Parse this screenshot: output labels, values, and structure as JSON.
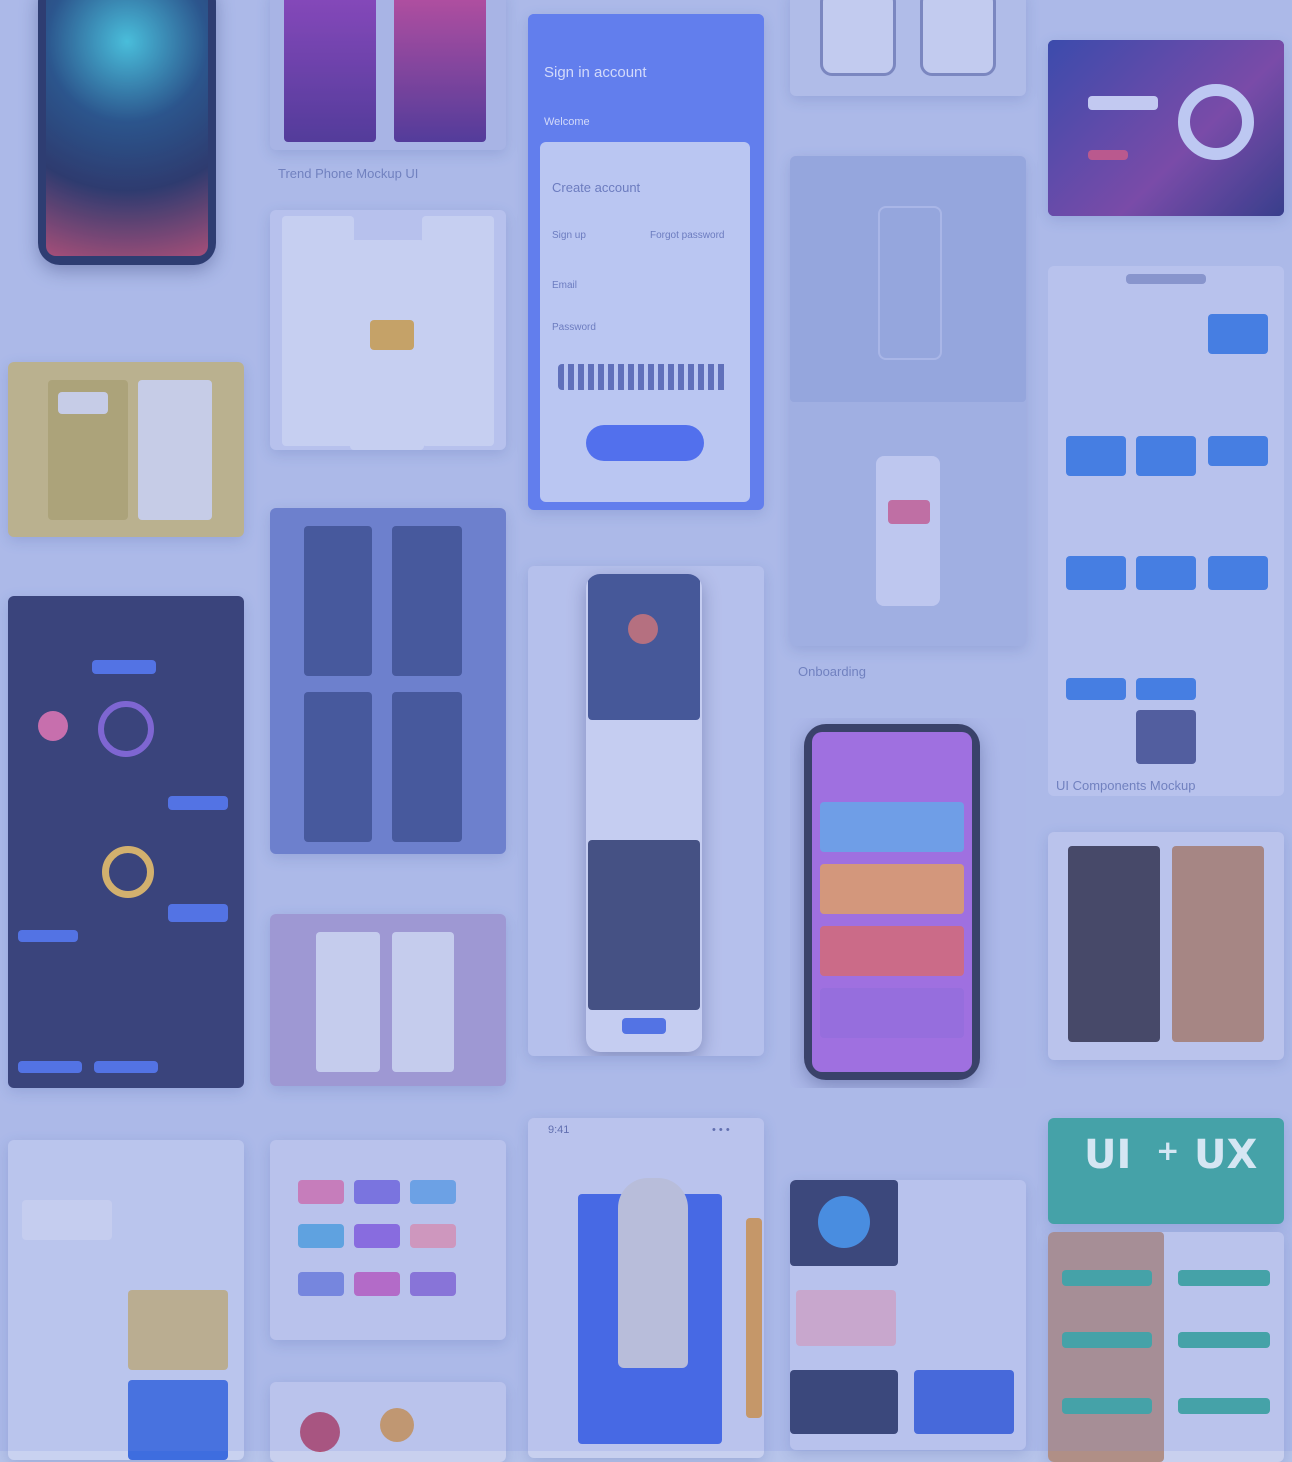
{
  "gallery": {
    "background": "#b7c4ea",
    "accent": "#5d7cf0",
    "captions": {
      "col2_card1": "Trend Phone Mockup UI",
      "col4_card2": "Onboarding",
      "col5_card2": "UI Components Mockup"
    },
    "login_card": {
      "title": "Sign in account",
      "subtitle": "Welcome",
      "field_title": "Create account",
      "tab_left": "Sign up",
      "tab_right": "Forgot password",
      "row_email": "Email",
      "row_password": "Password"
    },
    "ux_card": {
      "left": "UI",
      "right": "UX",
      "separator": "+"
    },
    "status_bar": {
      "time": "9:41",
      "signal": "• • •"
    },
    "icons": [
      "phone-mockup-icon",
      "chart-icon",
      "avatar-icon"
    ]
  }
}
